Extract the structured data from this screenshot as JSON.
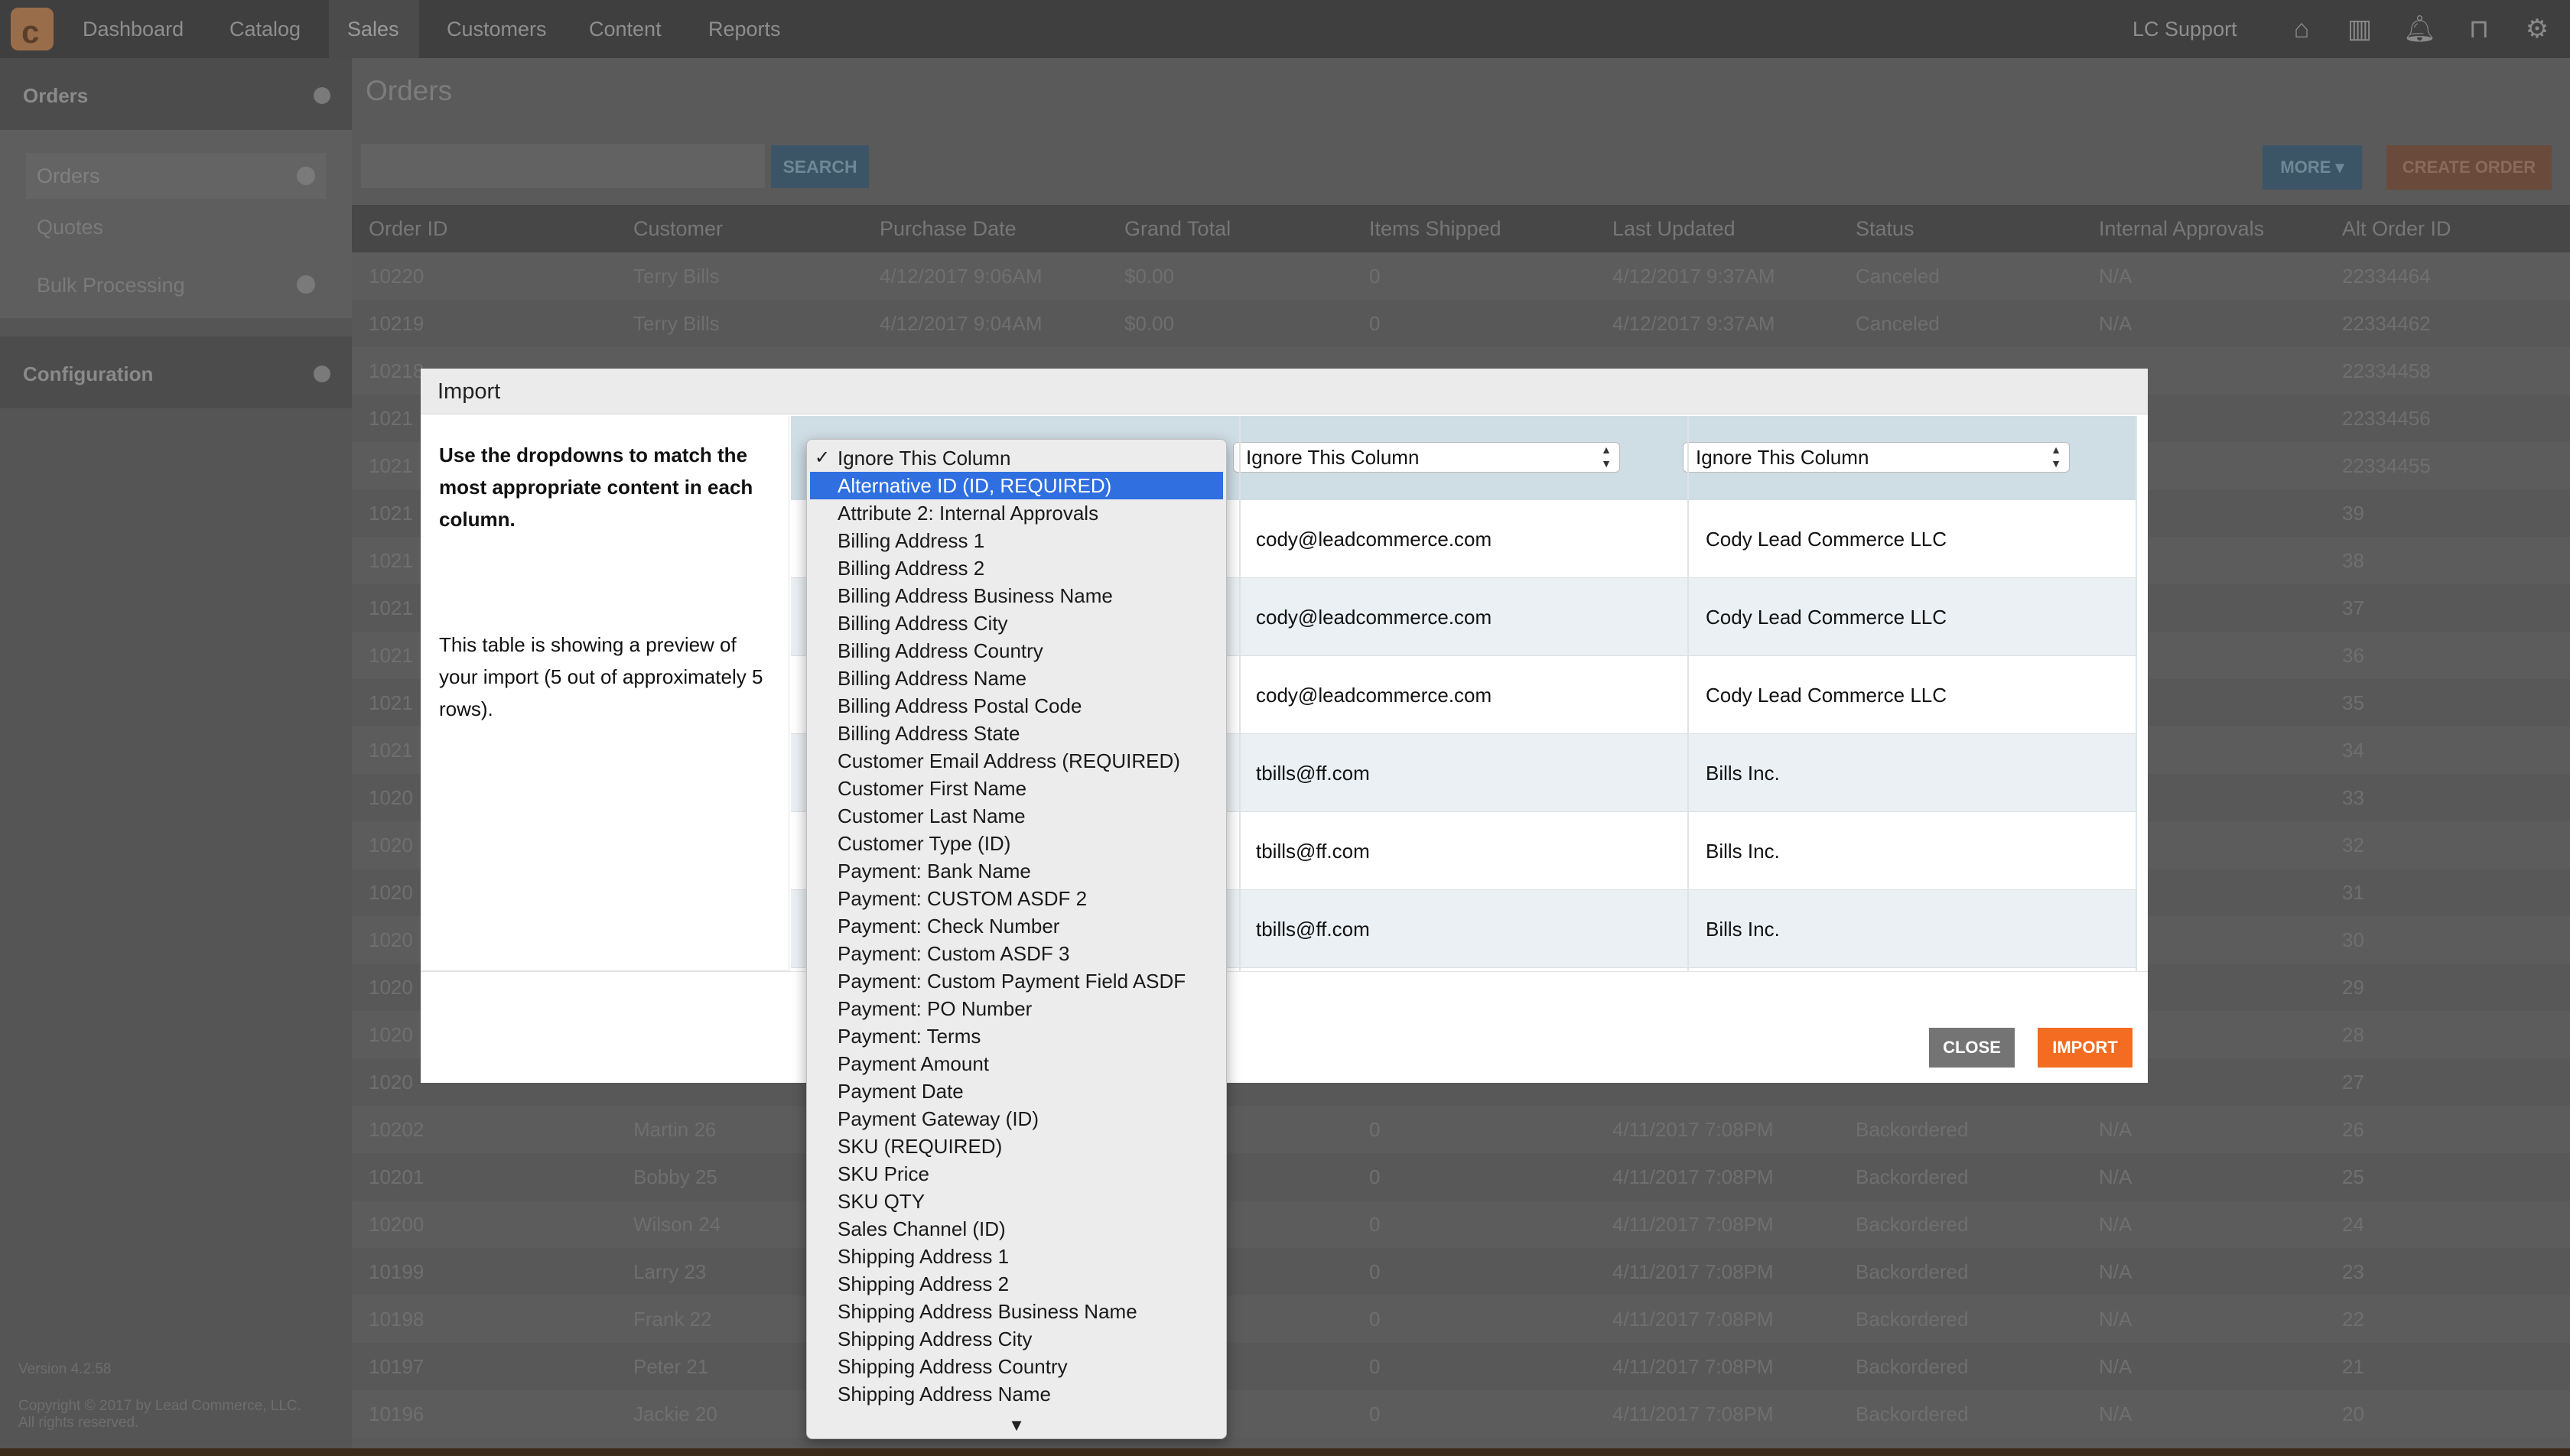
{
  "nav": {
    "items": [
      "Dashboard",
      "Catalog",
      "Sales",
      "Customers",
      "Content",
      "Reports"
    ],
    "active": "Sales",
    "user": "LC Support",
    "icons": [
      "home-icon",
      "book-icon",
      "bell-icon",
      "lock-icon",
      "gear-icon"
    ]
  },
  "sidebar": {
    "orders_title": "Orders",
    "links": [
      "Orders",
      "Quotes",
      "Bulk Processing"
    ],
    "config_title": "Configuration",
    "version": "Version 4.2.58",
    "copyright": "Copyright © 2017 by Lead Commerce, LLC.",
    "rights": "All rights reserved."
  },
  "main": {
    "title": "Orders",
    "search_label": "SEARCH",
    "more_label": "MORE ▾",
    "create_label": "CREATE ORDER",
    "columns": [
      "Order ID",
      "Customer",
      "Purchase Date",
      "Grand Total",
      "Items Shipped",
      "Last Updated",
      "Status",
      "Internal Approvals",
      "Alt Order ID"
    ],
    "rows": [
      [
        "10220",
        "Terry Bills",
        "4/12/2017 9:06AM",
        "$0.00",
        "0",
        "4/12/2017 9:37AM",
        "Canceled",
        "N/A",
        "22334464"
      ],
      [
        "10219",
        "Terry Bills",
        "4/12/2017 9:04AM",
        "$0.00",
        "0",
        "4/12/2017 9:37AM",
        "Canceled",
        "N/A",
        "22334462"
      ],
      [
        "10218",
        "",
        "",
        "",
        "",
        "",
        "",
        "",
        "22334458"
      ],
      [
        "1021",
        "",
        "",
        "",
        "",
        "",
        "",
        "",
        "22334456"
      ],
      [
        "1021",
        "",
        "",
        "",
        "",
        "",
        "",
        "",
        "22334455"
      ],
      [
        "1021",
        "",
        "",
        "",
        "",
        "",
        "",
        "",
        "39"
      ],
      [
        "1021",
        "",
        "",
        "",
        "",
        "",
        "",
        "",
        "38"
      ],
      [
        "1021",
        "",
        "",
        "",
        "",
        "",
        "",
        "",
        "37"
      ],
      [
        "1021",
        "",
        "",
        "",
        "",
        "",
        "",
        "",
        "36"
      ],
      [
        "1021",
        "",
        "",
        "",
        "",
        "",
        "",
        "",
        "35"
      ],
      [
        "1021",
        "",
        "",
        "",
        "",
        "",
        "",
        "",
        "34"
      ],
      [
        "1020",
        "",
        "",
        "",
        "",
        "",
        "",
        "",
        "33"
      ],
      [
        "1020",
        "",
        "",
        "",
        "",
        "",
        "",
        "",
        "32"
      ],
      [
        "1020",
        "",
        "",
        "",
        "",
        "",
        "",
        "",
        "31"
      ],
      [
        "1020",
        "",
        "",
        "",
        "",
        "",
        "",
        "",
        "30"
      ],
      [
        "1020",
        "",
        "",
        "",
        "",
        "",
        "",
        "",
        "29"
      ],
      [
        "1020",
        "",
        "",
        "",
        "",
        "",
        "",
        "",
        "28"
      ],
      [
        "1020",
        "",
        "",
        "",
        "",
        "",
        "",
        "",
        "27"
      ],
      [
        "10202",
        "Martin 26",
        "",
        "",
        "0",
        "4/11/2017 7:08PM",
        "Backordered",
        "N/A",
        "26"
      ],
      [
        "10201",
        "Bobby 25",
        "",
        "",
        "0",
        "4/11/2017 7:08PM",
        "Backordered",
        "N/A",
        "25"
      ],
      [
        "10200",
        "Wilson 24",
        "",
        "",
        "0",
        "4/11/2017 7:08PM",
        "Backordered",
        "N/A",
        "24"
      ],
      [
        "10199",
        "Larry 23",
        "",
        "",
        "0",
        "4/11/2017 7:08PM",
        "Backordered",
        "N/A",
        "23"
      ],
      [
        "10198",
        "Frank 22",
        "",
        "",
        "0",
        "4/11/2017 7:08PM",
        "Backordered",
        "N/A",
        "22"
      ],
      [
        "10197",
        "Peter 21",
        "",
        "",
        "0",
        "4/11/2017 7:08PM",
        "Backordered",
        "N/A",
        "21"
      ],
      [
        "10196",
        "Jackie 20",
        "",
        "",
        "0",
        "4/11/2017 7:08PM",
        "Backordered",
        "N/A",
        "20"
      ]
    ]
  },
  "modal": {
    "title": "Import",
    "instructions_bold": "Use the dropdowns to match the most appropriate content in each column.",
    "instructions_text": "This table is showing a preview of your import (5 out of approximately 5 rows).",
    "header_selects": [
      "Ignore This Column",
      "Ignore This Column"
    ],
    "preview_rows": [
      [
        "cody@leadcommerce.com",
        "Cody Lead Commerce LLC"
      ],
      [
        "cody@leadcommerce.com",
        "Cody Lead Commerce LLC"
      ],
      [
        "cody@leadcommerce.com",
        "Cody Lead Commerce LLC"
      ],
      [
        "tbills@ff.com",
        "Bills Inc."
      ],
      [
        "tbills@ff.com",
        "Bills Inc."
      ],
      [
        "tbills@ff.com",
        "Bills Inc."
      ]
    ],
    "close_label": "CLOSE",
    "import_label": "IMPORT"
  },
  "dropdown": {
    "checked": "Ignore This Column",
    "highlighted": "Alternative ID (ID, REQUIRED)",
    "options": [
      "Ignore This Column",
      "Alternative ID (ID, REQUIRED)",
      "Attribute 2: Internal Approvals",
      "Billing Address 1",
      "Billing Address 2",
      "Billing Address Business Name",
      "Billing Address City",
      "Billing Address Country",
      "Billing Address Name",
      "Billing Address Postal Code",
      "Billing Address State",
      "Customer Email Address (REQUIRED)",
      "Customer First Name",
      "Customer Last Name",
      "Customer Type (ID)",
      "Payment: Bank Name",
      "Payment: CUSTOM ASDF 2",
      "Payment: Check Number",
      "Payment: Custom ASDF 3",
      "Payment: Custom Payment Field ASDF",
      "Payment: PO Number",
      "Payment: Terms",
      "Payment Amount",
      "Payment Date",
      "Payment Gateway (ID)",
      "SKU (REQUIRED)",
      "SKU Price",
      "SKU QTY",
      "Sales Channel (ID)",
      "Shipping Address 1",
      "Shipping Address 2",
      "Shipping Address Business Name",
      "Shipping Address City",
      "Shipping Address Country",
      "Shipping Address Name"
    ],
    "scroll_indicator": "▼"
  },
  "colors": {
    "accent_orange": "#f36c21",
    "highlight_blue": "#2f6fe0",
    "grid_header": "#cfdde5"
  }
}
